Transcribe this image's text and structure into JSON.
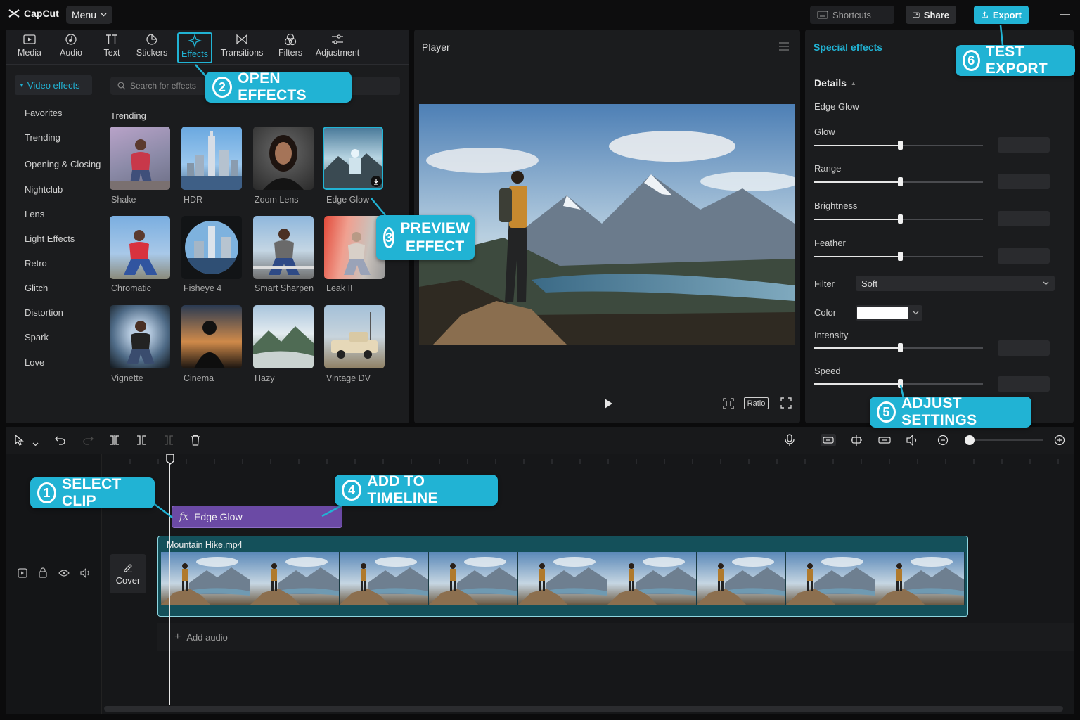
{
  "app": {
    "name": "CapCut",
    "menu_label": "Menu"
  },
  "topbar": {
    "shortcuts_label": "Shortcuts",
    "share_label": "Share",
    "export_label": "Export"
  },
  "tools": [
    {
      "label": "Media",
      "icon": "media-icon"
    },
    {
      "label": "Audio",
      "icon": "audio-icon"
    },
    {
      "label": "Text",
      "icon": "text-icon"
    },
    {
      "label": "Stickers",
      "icon": "stickers-icon"
    },
    {
      "label": "Effects",
      "icon": "effects-icon",
      "active": true
    },
    {
      "label": "Transitions",
      "icon": "transitions-icon"
    },
    {
      "label": "Filters",
      "icon": "filters-icon"
    },
    {
      "label": "Adjustment",
      "icon": "adjustment-icon"
    }
  ],
  "categories": {
    "active": "Video effects",
    "items": [
      "Favorites",
      "Trending",
      "Opening & Closing",
      "Nightclub",
      "Lens",
      "Light Effects",
      "Retro",
      "Glitch",
      "Distortion",
      "Spark",
      "Love"
    ]
  },
  "search": {
    "placeholder": "Search for effects"
  },
  "section_title": "Trending",
  "effects": [
    "Shake",
    "HDR",
    "Zoom Lens",
    "Edge Glow",
    "Chromatic",
    "Fisheye 4",
    "Smart Sharpen",
    "Leak II",
    "Vignette",
    "Cinema",
    "Hazy",
    "Vintage DV"
  ],
  "player": {
    "title": "Player",
    "ratio_label": "Ratio"
  },
  "props": {
    "title": "Special effects",
    "details_label": "Details",
    "effect_name": "Edge Glow",
    "sliders": [
      {
        "label": "Glow",
        "value": 0.51
      },
      {
        "label": "Range",
        "value": 0.51
      },
      {
        "label": "Brightness",
        "value": 0.51
      },
      {
        "label": "Feather",
        "value": 0.51
      },
      {
        "label": "Intensity",
        "value": 0.51
      },
      {
        "label": "Speed",
        "value": 0.51
      }
    ],
    "filter_label": "Filter",
    "filter_value": "Soft",
    "color_label": "Color",
    "color_value": "#ffffff"
  },
  "timeline": {
    "effect_clip_label": "Edge Glow",
    "video_clip_label": "Mountain Hike.mp4",
    "cover_label": "Cover",
    "add_audio_label": "Add audio",
    "zoom_level": 0
  },
  "callouts": [
    {
      "num": "1",
      "text": "SELECT CLIP"
    },
    {
      "num": "2",
      "text": "OPEN EFFECTS"
    },
    {
      "num": "3",
      "text_line1": "PREVIEW",
      "text_line2": "EFFECT"
    },
    {
      "num": "4",
      "text": "ADD TO TIMELINE"
    },
    {
      "num": "5",
      "text": "ADJUST SETTINGS"
    },
    {
      "num": "6",
      "text": "TEST EXPORT"
    }
  ],
  "colors": {
    "accent": "#21b3d4",
    "effect_clip": "#6b4aa5",
    "video_clip": "#14505a"
  }
}
